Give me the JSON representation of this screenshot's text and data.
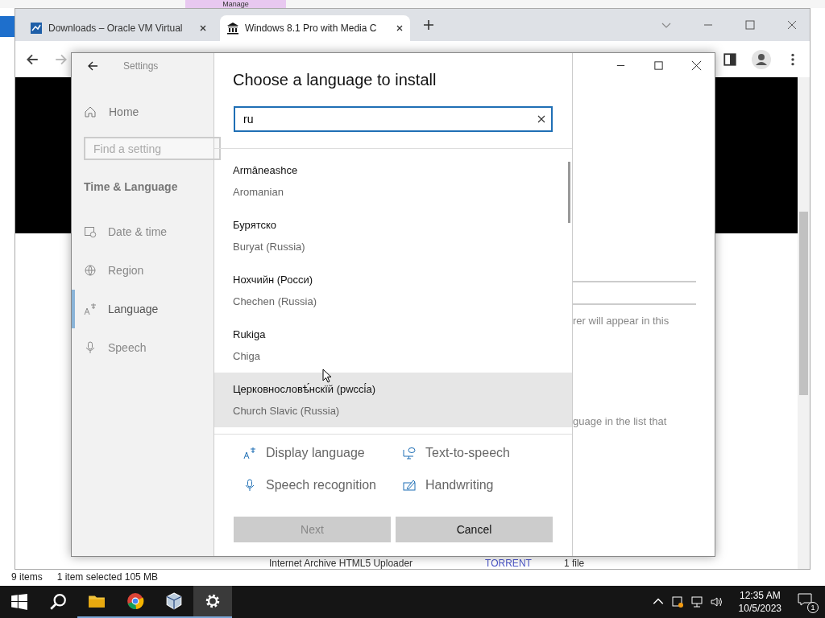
{
  "file_explorer": {
    "ribbon_tab": "Manage",
    "status_items": "9 items",
    "status_selection": "1 item selected  105 MB"
  },
  "browser": {
    "tabs": [
      {
        "kind": "virtualbox",
        "title": "Downloads – Oracle VM Virtual",
        "selected": false
      },
      {
        "kind": "archive",
        "title": "Windows 8.1 Pro with Media C",
        "selected": true
      }
    ],
    "page": {
      "uploader": "Internet Archive HTML5 Uploader",
      "torrent_link": "TORRENT",
      "file_count": "1 file"
    }
  },
  "settings": {
    "back_title": "Settings",
    "home": "Home",
    "search_placeholder": "Find a setting",
    "section": "Time & Language",
    "nav": [
      {
        "kind": "clock",
        "label": "Date & time",
        "selected": false
      },
      {
        "kind": "globe",
        "label": "Region",
        "selected": false
      },
      {
        "kind": "language",
        "label": "Language",
        "selected": true
      },
      {
        "kind": "mic",
        "label": "Speech",
        "selected": false
      }
    ],
    "behind_text_1": "rer will appear in this",
    "behind_text_2": "guage in the list that"
  },
  "dialog": {
    "title": "Choose a language to install",
    "search_value": "ru",
    "languages": [
      {
        "native": "Armâneashce",
        "english": "Aromanian",
        "selected": false
      },
      {
        "native": "Бурятско",
        "english": "Buryat (Russia)",
        "selected": false
      },
      {
        "native": "Нохчийн (Росси)",
        "english": "Chechen (Russia)",
        "selected": false
      },
      {
        "native": "Rukiga",
        "english": "Chiga",
        "selected": false
      },
      {
        "native": "Церковнословѣ́нскїй (рwссі́а)",
        "english": "Church Slavic (Russia)",
        "selected": true
      }
    ],
    "features": [
      {
        "kind": "display",
        "label": "Display language"
      },
      {
        "kind": "tts",
        "label": "Text-to-speech"
      },
      {
        "kind": "mic",
        "label": "Speech recognition"
      },
      {
        "kind": "pen",
        "label": "Handwriting"
      }
    ],
    "next": {
      "label": "Next",
      "disabled": true
    },
    "cancel": {
      "label": "Cancel",
      "disabled": false
    }
  },
  "taskbar": {
    "apps": [
      {
        "kind": "start",
        "selected": false,
        "running": false
      },
      {
        "kind": "search",
        "selected": false,
        "running": false
      },
      {
        "kind": "folder",
        "selected": false,
        "running": true
      },
      {
        "kind": "chrome",
        "selected": false,
        "running": true
      },
      {
        "kind": "cube",
        "selected": false,
        "running": true
      },
      {
        "kind": "gear",
        "selected": true,
        "running": true
      }
    ],
    "time": "12:35 AM",
    "date": "10/5/2023",
    "notifications": "1"
  }
}
